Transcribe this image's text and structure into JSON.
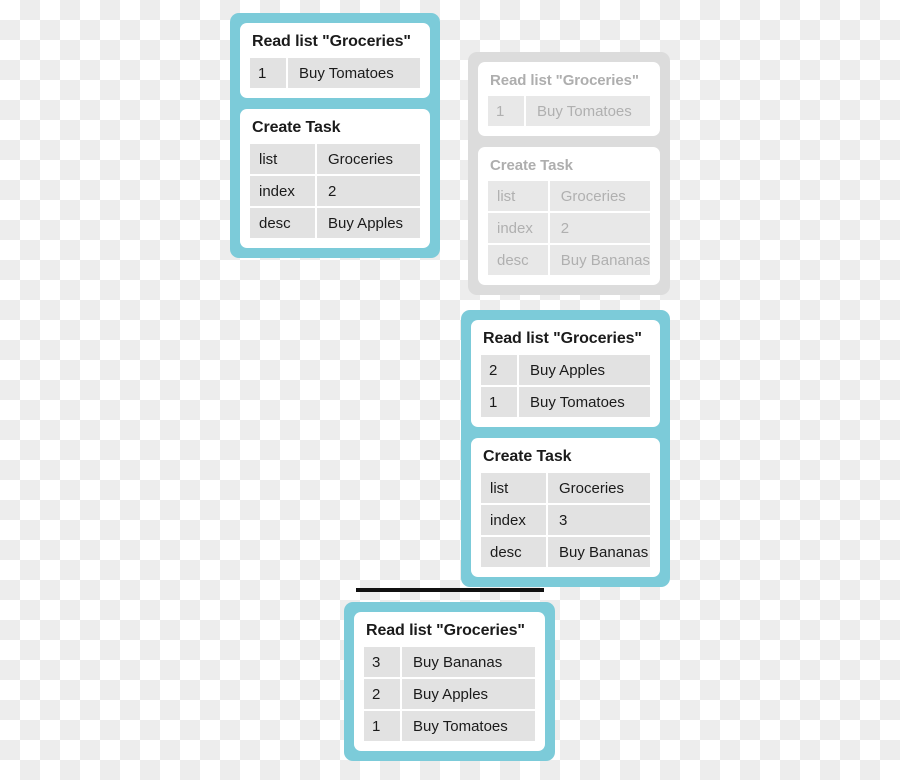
{
  "colors": {
    "accent_teal": "#7ccbd9",
    "ghost_gray": "#dcdcdc",
    "cell_gray": "#e2e2e2",
    "text_dark": "#1b1b1b",
    "text_ghost": "#b0b0b0",
    "divider_black": "#111111"
  },
  "labels": {
    "read_list_title": "Read list \"Groceries\"",
    "create_task_title": "Create Task",
    "key_list": "list",
    "key_index": "index",
    "key_desc": "desc"
  },
  "panels": {
    "step1": {
      "read_card": {
        "title": "Read list \"Groceries\"",
        "rows": [
          {
            "index": "1",
            "desc": "Buy Tomatoes"
          }
        ]
      },
      "create_card": {
        "title": "Create Task",
        "fields": [
          {
            "key": "list",
            "value": "Groceries"
          },
          {
            "key": "index",
            "value": "2"
          },
          {
            "key": "desc",
            "value": "Buy Apples"
          }
        ]
      }
    },
    "ghost": {
      "read_card": {
        "title": "Read list \"Groceries\"",
        "rows": [
          {
            "index": "1",
            "desc": "Buy Tomatoes"
          }
        ]
      },
      "create_card": {
        "title": "Create Task",
        "fields": [
          {
            "key": "list",
            "value": "Groceries"
          },
          {
            "key": "index",
            "value": "2"
          },
          {
            "key": "desc",
            "value": "Buy Bananas"
          }
        ]
      }
    },
    "step2": {
      "read_card": {
        "title": "Read list \"Groceries\"",
        "rows": [
          {
            "index": "2",
            "desc": "Buy Apples"
          },
          {
            "index": "1",
            "desc": "Buy Tomatoes"
          }
        ]
      },
      "create_card": {
        "title": "Create Task",
        "fields": [
          {
            "key": "list",
            "value": "Groceries"
          },
          {
            "key": "index",
            "value": "3"
          },
          {
            "key": "desc",
            "value": "Buy Bananas"
          }
        ]
      }
    },
    "step3": {
      "read_card": {
        "title": "Read list \"Groceries\"",
        "rows": [
          {
            "index": "3",
            "desc": "Buy Bananas"
          },
          {
            "index": "2",
            "desc": "Buy Apples"
          },
          {
            "index": "1",
            "desc": "Buy Tomatoes"
          }
        ]
      }
    }
  }
}
